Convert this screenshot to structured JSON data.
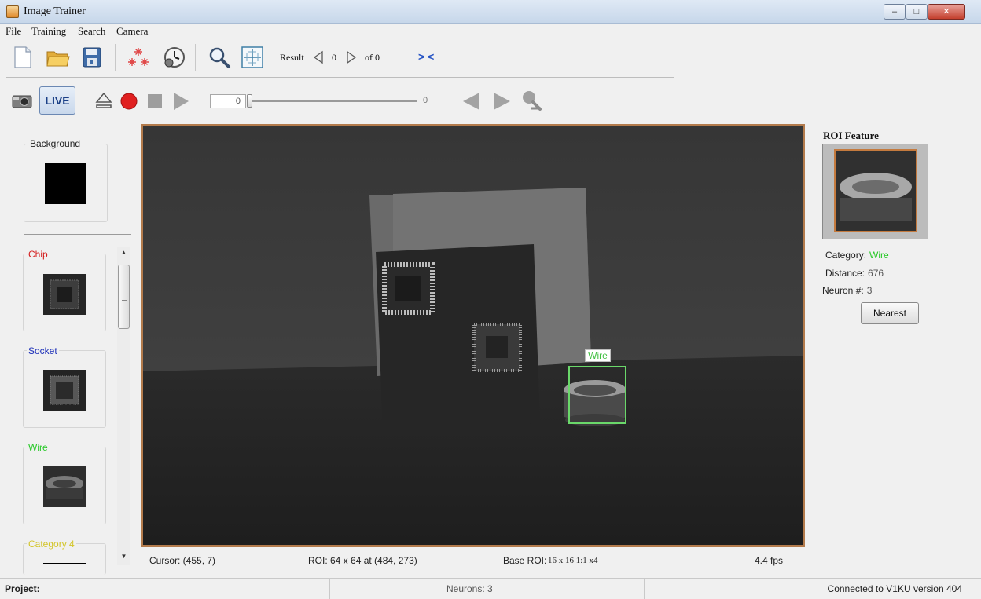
{
  "window": {
    "title": "Image Trainer"
  },
  "menu": [
    "File",
    "Training",
    "Search",
    "Camera"
  ],
  "toolbar": {
    "result_label": "Result",
    "result_index": "0",
    "result_of": "of 0",
    "collapse_label": "> <"
  },
  "playback": {
    "live_label": "LIVE",
    "frame_box": "0",
    "slider_value": "0"
  },
  "categories": [
    {
      "name": "Background",
      "color": "#333333"
    },
    {
      "name": "Chip",
      "color": "#d41c1c"
    },
    {
      "name": "Socket",
      "color": "#1c2fb8"
    },
    {
      "name": "Wire",
      "color": "#26c826"
    },
    {
      "name": "Category 4",
      "color": "#d3c52a"
    }
  ],
  "image": {
    "roi_label": "Wire",
    "cursor": "Cursor: (455, 7)",
    "roi": "ROI: 64 x 64  at  (484, 273)",
    "base_roi_label": "Base ROI:",
    "base_roi_value": "16 x 16   1:1   x4",
    "fps": "4.4 fps"
  },
  "roi_feature": {
    "title": "ROI Feature",
    "category_label": "Category:",
    "category_value": "Wire",
    "category_color": "#26c826",
    "distance_label": "Distance:",
    "distance_value": "676",
    "neuron_label": "Neuron #:",
    "neuron_value": "3",
    "nearest_button": "Nearest"
  },
  "status": {
    "project_label": "Project:",
    "neurons": "Neurons: 3",
    "connection": "Connected to V1KU version 404"
  }
}
